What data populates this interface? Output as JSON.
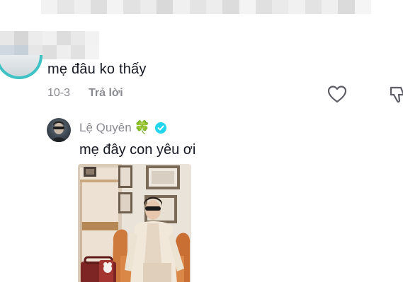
{
  "comment": {
    "text": "mẹ đâu ko thấy",
    "date": "10-3",
    "reply_label": "Trả lời"
  },
  "reply": {
    "username": "Lệ Quyên",
    "username_emoji": "🍀",
    "text": "mẹ đây con yêu ơi"
  },
  "colors": {
    "primary_text": "#161823",
    "secondary_text": "#8a8b91",
    "verified": "#20d5ec",
    "avatar_ring": "#3fc2c5"
  },
  "icons": [
    "heart-outline-icon",
    "dislike-icon",
    "clover-icon",
    "verified-badge-icon"
  ]
}
